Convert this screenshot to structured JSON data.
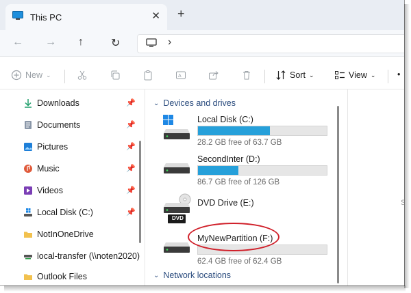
{
  "window": {
    "tab_title": "This PC",
    "tab_close": "✕",
    "new_tab": "+"
  },
  "nav": {
    "back": "←",
    "forward": "→",
    "up": "↑",
    "refresh": "↻",
    "breadcrumb_chevron": "›"
  },
  "toolbar": {
    "new_label": "New",
    "sort_label": "Sort",
    "view_label": "View",
    "more": "•"
  },
  "sidebar": {
    "items": [
      {
        "label": "Downloads",
        "icon": "download-icon",
        "pinned": true
      },
      {
        "label": "Documents",
        "icon": "documents-icon",
        "pinned": true
      },
      {
        "label": "Pictures",
        "icon": "pictures-icon",
        "pinned": true
      },
      {
        "label": "Music",
        "icon": "music-icon",
        "pinned": true
      },
      {
        "label": "Videos",
        "icon": "videos-icon",
        "pinned": true
      },
      {
        "label": "Local Disk (C:)",
        "icon": "drive-icon",
        "pinned": true
      },
      {
        "label": "NotInOneDrive",
        "icon": "folder-icon",
        "pinned": false
      },
      {
        "label": "local-transfer (\\\\noten2020)",
        "icon": "network-drive-icon",
        "pinned": false
      },
      {
        "label": "Outlook Files",
        "icon": "folder-icon",
        "pinned": false
      }
    ]
  },
  "main": {
    "devices_heading": "Devices and drives",
    "network_heading": "Network locations",
    "right_hint": "S",
    "drives": [
      {
        "name": "Local Disk (C:)",
        "free": "28.2 GB free of 63.7 GB",
        "used_fraction": 0.557,
        "windows_logo": true
      },
      {
        "name": "SecondInter (D:)",
        "free": "86.7 GB free of 126 GB",
        "used_fraction": 0.312
      },
      {
        "name": "DVD Drive (E:)",
        "dvd_label": "DVD"
      },
      {
        "name": "MyNewPartition (F:)",
        "free": "62.4 GB free of 62.4 GB",
        "used_fraction": 0.0
      }
    ]
  },
  "colors": {
    "accent": "#26a0da",
    "annotation": "#d0202a",
    "section_text": "#2b4c7e"
  }
}
